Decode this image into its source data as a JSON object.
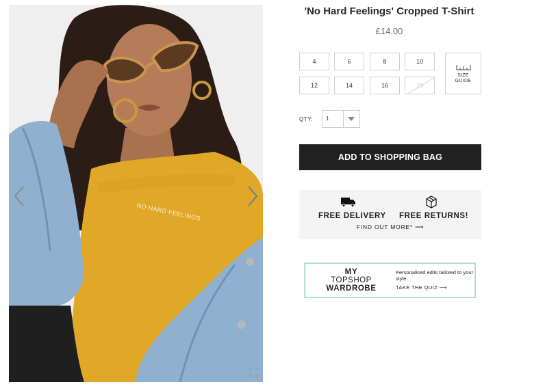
{
  "product": {
    "title": "'No Hard Feelings' Cropped T-Shirt",
    "price": "£14.00",
    "tshirt_print": "NO HARD FEELINGS"
  },
  "gallery": {
    "prev_icon": "chevron-left-icon",
    "next_icon": "chevron-right-icon"
  },
  "sizes": [
    {
      "label": "4",
      "available": true
    },
    {
      "label": "6",
      "available": true
    },
    {
      "label": "8",
      "available": true
    },
    {
      "label": "10",
      "available": true
    },
    {
      "label": "12",
      "available": true
    },
    {
      "label": "14",
      "available": true
    },
    {
      "label": "16",
      "available": true
    },
    {
      "label": "18",
      "available": false
    }
  ],
  "size_guide": {
    "line1": "SIZE",
    "line2": "GUIDE",
    "icon": "ruler-icon"
  },
  "quantity": {
    "label": "QTY:",
    "value": "1"
  },
  "add_to_bag": "ADD TO SHOPPING BAG",
  "delivery": {
    "free_delivery": "FREE DELIVERY",
    "free_returns": "FREE RETURNS!",
    "find_out_more": "FIND OUT MORE* ⟶",
    "delivery_icon": "truck-icon",
    "returns_icon": "package-icon"
  },
  "wardrobe": {
    "logo_my": "MY",
    "logo_topshop": "TOPSHOP",
    "logo_wardrobe": "WARDROBE",
    "tagline": "Personalised edits tailored to your style.",
    "cta": "TAKE THE QUIZ ⟶",
    "border_color": "#b7dcd7"
  },
  "colors": {
    "button_bg": "#212121",
    "tshirt": "#e0a826",
    "denim": "#8fb0cf"
  }
}
